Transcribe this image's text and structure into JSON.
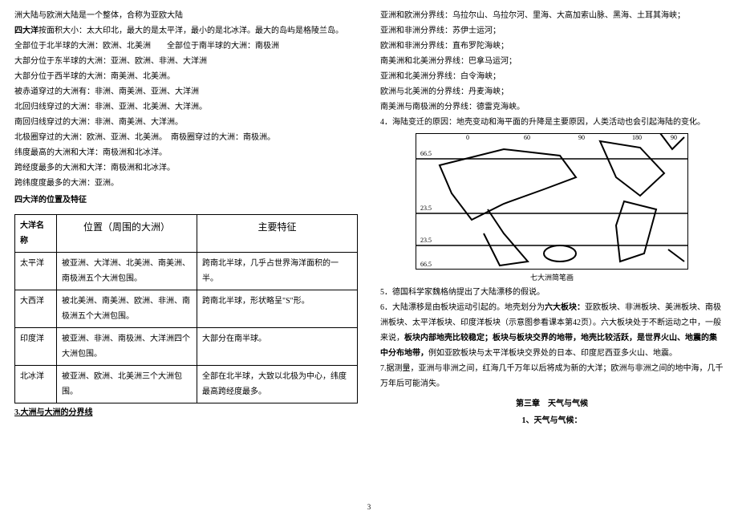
{
  "left": {
    "l1a": "洲大陆与欧洲大陆是一个整体，合称为亚欧大陆",
    "l2_b": "四大洋",
    "l2_r": "按面积大小：太大印北，最大的是太平洋，最小的是北冰洋。最大的岛屿是格陵兰岛。",
    "l3": "全部位于北半球的大洲：欧洲、北美洲　　全部位于南半球的大洲：南极洲",
    "l4": "大部分位于东半球的大洲：亚洲、欧洲、非洲、大洋洲",
    "l5": "大部分位于西半球的大洲：南美洲、北美洲。",
    "l6": "被赤道穿过的大洲有：非洲、南美洲、亚洲、大洋洲",
    "l7": "北回归线穿过的大洲：非洲、亚洲、北美洲、大洋洲。",
    "l8": "南回归线穿过的大洲：非洲、南美洲、大洋洲。",
    "l9": "北极圈穿过的大洲：欧洲、亚洲、北美洲。　南极圈穿过的大洲：南极洲。",
    "l10": "纬度最高的大洲和大洋：南极洲和北冰洋。",
    "l11": "跨经度最多的大洲和大洋：南极洲和北冰洋。",
    "l12": "跨纬度度最多的大洲：亚洲。",
    "section": "四大洋的位置及特征",
    "table": {
      "h1": "大洋名称",
      "h2": "位置（周围的大洲）",
      "h3": "主要特征",
      "rows": [
        {
          "c1": "太平洋",
          "c2": "被亚洲、大洋洲、北美洲、南美洲、南极洲五个大洲包围。",
          "c3": "跨南北半球，几乎占世界海洋面积的一半。"
        },
        {
          "c1": "大西洋",
          "c2": "被北美洲、南美洲、欧洲、非洲、南极洲五个大洲包围。",
          "c3": "跨南北半球，形状略呈\"S\"形。"
        },
        {
          "c1": "印度洋",
          "c2": "被亚洲、非洲、南极洲、大洋洲四个大洲包围。",
          "c3": "大部分在南半球。"
        },
        {
          "c1": "北冰洋",
          "c2": "被亚洲、欧洲、北美洲三个大洲包围。",
          "c3": "全部在北半球，大致以北极为中心，纬度最高跨经度最多。"
        }
      ]
    },
    "foot": "3.大洲与大洲的分界线"
  },
  "right": {
    "r1": "亚洲和欧洲分界线：乌拉尔山、乌拉尔河、里海、大高加索山脉、黑海、土耳其海峡；",
    "r2": "亚洲和非洲分界线：苏伊士运河；",
    "r3": "欧洲和非洲分界线：直布罗陀海峡；",
    "r4": "南美洲和北美洲分界线：巴拿马运河；",
    "r5": "亚洲和北美洲分界线：白令海峡；",
    "r6": "欧洲与北美洲的分界线：丹麦海峡；",
    "r7": "南美洲与南极洲的分界线：德雷克海峡。",
    "r8": "4．海陆变迁的原因：地壳变动和海平面的升降是主要原因，人类活动也会引起海陆的变化。",
    "map_caption": "七大洲简笔画",
    "r9": "5．德国科学家魏格纳提出了大陆漂移的假说。",
    "r10a": "6．大陆漂移是由板块运动引起的。地壳划分为",
    "r10b": "六大板块：",
    "r10c": "亚欧板块、非洲板块、美洲板块、南极洲板块、太平洋板块、印度洋板块（示意图参看课本第42页）。六大板块处于不断运动之中，一般来说，",
    "r10d": "板块内部地壳比较稳定；板块与板块交界的地带，地壳比较活跃，是世界火山、地震的集中分布地带，",
    "r10e": "例如亚欧板块与太平洋板块交界处的日本、印度尼西亚多火山、地震。",
    "r11": "7.据测量，亚洲与非洲之间，红海几千万年以后将成为新的大洋；欧洲与非洲之间的地中海，几千万年后可能消失。",
    "chapter": "第三章　天气与气候",
    "sub": "1、天气与气候："
  },
  "pagenum": "3"
}
